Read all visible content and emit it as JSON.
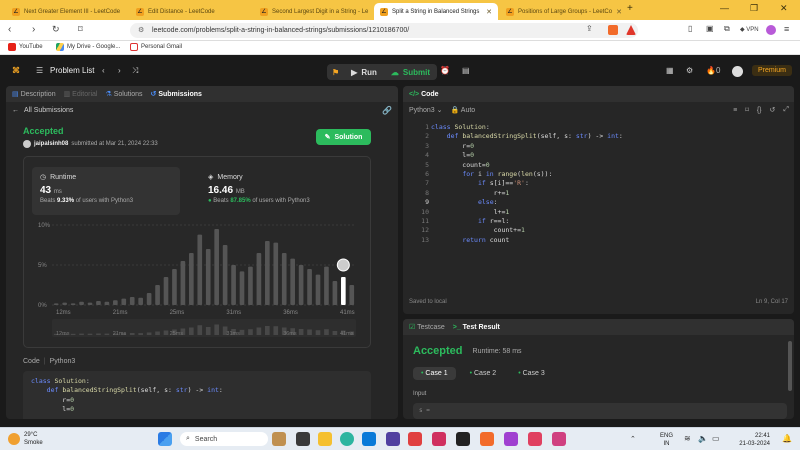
{
  "browser": {
    "tabs": [
      {
        "title": "Next Greater Element III - LeetCode",
        "active": false
      },
      {
        "title": "Edit Distance - LeetCode",
        "active": false
      },
      {
        "title": "Second Largest Digit in a String - Le",
        "active": false
      },
      {
        "title": "Split a String in Balanced Strings",
        "active": true
      },
      {
        "title": "Positions of Large Groups - LeetCo",
        "active": false
      }
    ],
    "url": "leetcode.com/problems/split-a-string-in-balanced-strings/submissions/1210186700/",
    "vpn_label": "VPN",
    "bookmarks": [
      "YouTube",
      "My Drive - Google...",
      "Personal Gmail"
    ]
  },
  "header": {
    "problem_list": "Problem List",
    "run": "Run",
    "submit": "Submit",
    "streak": "0",
    "premium": "Premium"
  },
  "left": {
    "tabs": [
      "Description",
      "Editorial",
      "Solutions",
      "Submissions"
    ],
    "all_submissions": "All Submissions",
    "status": "Accepted",
    "user": "jaipalsinh08",
    "submitted_at": "submitted at Mar 21, 2024 22:33",
    "solution_btn": "Solution",
    "runtime": {
      "label": "Runtime",
      "value": "43",
      "unit": "ms",
      "beats_pre": "Beats",
      "beats": "9.33%",
      "beats_post": "of users with Python3"
    },
    "memory": {
      "label": "Memory",
      "value": "16.46",
      "unit": "MB",
      "beats_pre": "Beats",
      "beats": "87.85%",
      "beats_post": "of users with Python3"
    },
    "code_header": "Code",
    "code_lang": "Python3",
    "code_preview": [
      "class Solution:",
      "    def balancedStringSplit(self, s: str) -> int:",
      "        r=0",
      "        l=0"
    ]
  },
  "chart_data": {
    "type": "bar",
    "y_ticks": [
      "10%",
      "5%",
      "0%"
    ],
    "x_ticks": [
      "12ms",
      "21ms",
      "25ms",
      "31ms",
      "36ms",
      "41ms"
    ],
    "ylim": [
      0,
      10
    ],
    "values": [
      0.2,
      0.3,
      0.2,
      0.4,
      0.3,
      0.5,
      0.4,
      0.6,
      0.8,
      1.0,
      0.9,
      1.5,
      2.5,
      3.5,
      4.5,
      5.5,
      6.5,
      8.8,
      7.0,
      9.5,
      7.5,
      5.0,
      4.2,
      4.8,
      6.5,
      8.0,
      7.8,
      6.5,
      5.8,
      5.0,
      4.5,
      3.8,
      4.8,
      3.0,
      3.5,
      2.5
    ],
    "highlight_index": 34
  },
  "editor": {
    "title": "Code",
    "lang": "Python3",
    "mode": "Auto",
    "saved": "Saved to local",
    "cursor": "Ln 9, Col 17",
    "lines": [
      "class Solution:",
      "    def balancedStringSplit(self, s: str) -> int:",
      "        r=0",
      "        l=0",
      "        count=0",
      "        for i in range(len(s)):",
      "            if s[i]=='R':",
      "                r+=1",
      "            else:",
      "                l+=1",
      "            if r==l:",
      "                count+=1",
      "        return count"
    ]
  },
  "result": {
    "tabs": [
      "Testcase",
      "Test Result"
    ],
    "status": "Accepted",
    "runtime": "Runtime: 58 ms",
    "cases": [
      "Case 1",
      "Case 2",
      "Case 3"
    ],
    "input_label": "Input",
    "input_value": "s ="
  },
  "taskbar": {
    "weather_temp": "29°C",
    "weather_desc": "Smoke",
    "search": "Search",
    "lang": "ENG",
    "region": "IN",
    "time": "22:41",
    "date": "21-03-2024"
  }
}
